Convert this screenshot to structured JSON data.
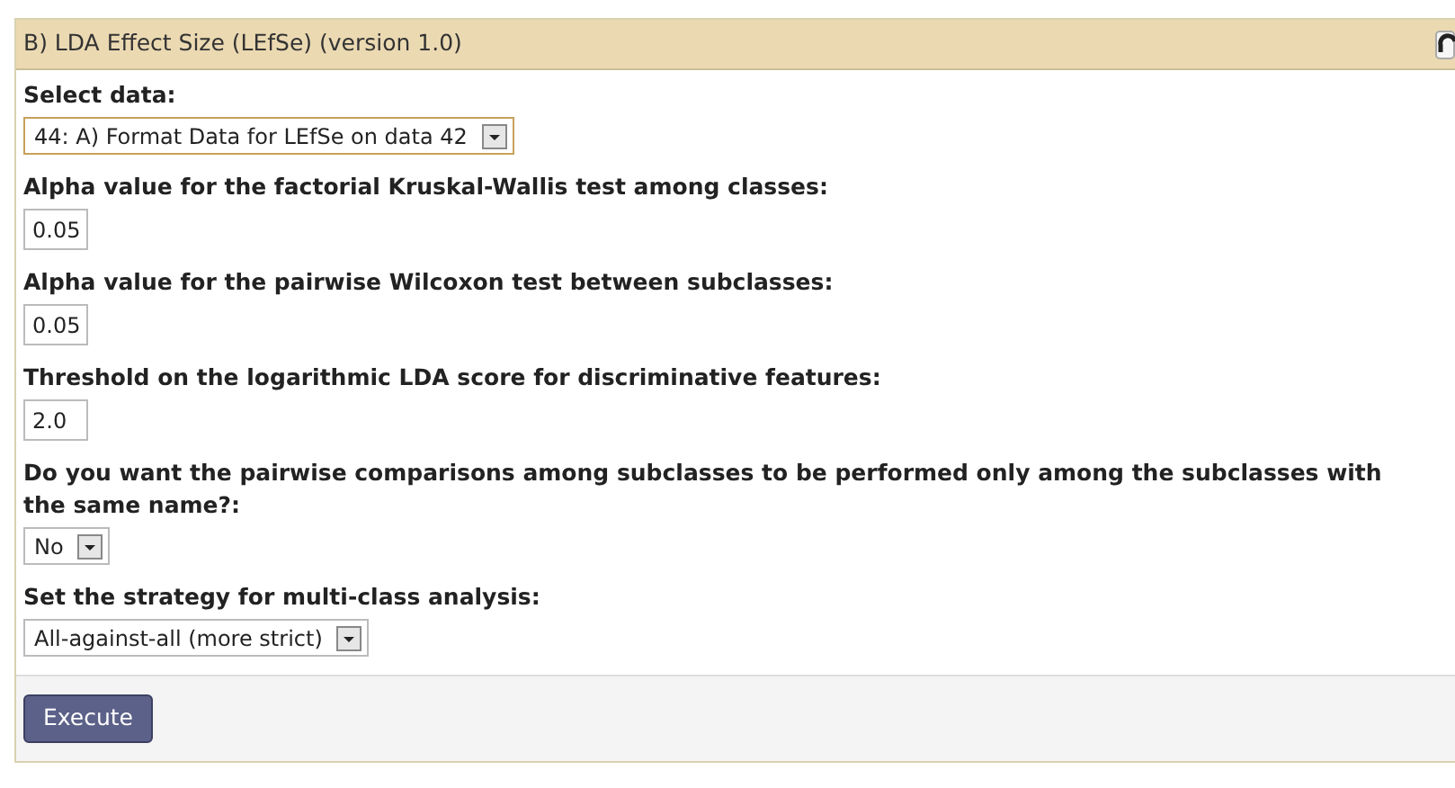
{
  "panel": {
    "title": "B) LDA Effect Size (LEfSe) (version 1.0)"
  },
  "fields": [
    {
      "kind": "select",
      "label": "Select data:",
      "value": "44: A) Format Data for LEfSe on data 42",
      "focused": true
    },
    {
      "kind": "text",
      "label": "Alpha value for the factorial Kruskal-Wallis test among classes:",
      "value": "0.05",
      "focused": false
    },
    {
      "kind": "text",
      "label": "Alpha value for the pairwise Wilcoxon test between subclasses:",
      "value": "0.05",
      "focused": false
    },
    {
      "kind": "text",
      "label": "Threshold on the logarithmic LDA score for discriminative features:",
      "value": "2.0",
      "focused": false
    },
    {
      "kind": "select",
      "label": "Do you want the pairwise comparisons among subclasses to be performed only among the subclasses with the same name?:",
      "value": "No",
      "focused": false
    },
    {
      "kind": "select",
      "label": "Set the strategy for multi-class analysis:",
      "value": "All-against-all (more strict)",
      "focused": false
    }
  ],
  "button": "Execute"
}
